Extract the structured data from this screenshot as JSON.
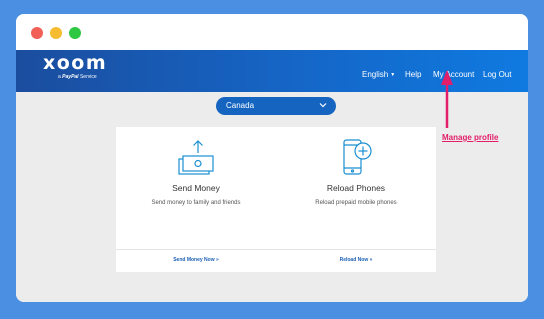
{
  "navbar": {
    "logo_word": "xoom",
    "logo_prefix": "a",
    "logo_brand": "PayPal",
    "logo_suffix": "Service",
    "language": "English",
    "help": "Help",
    "my_account": "My Account",
    "logout": "Log Out"
  },
  "country_select": {
    "value": "Canada"
  },
  "cards": [
    {
      "title": "Send Money",
      "description": "Send money to family and friends",
      "link": "Send Money Now »"
    },
    {
      "title": "Reload Phones",
      "description": "Reload prepaid mobile phones",
      "link": "Reload Now »"
    }
  ],
  "annotation": {
    "text": "Manage profile",
    "color": "#e21d69"
  },
  "colors": {
    "background": "#4b8fe2",
    "nav_start": "#1b4d9e",
    "nav_end": "#0f7ae0",
    "accent": "#1565c0",
    "icon": "#1a8fd1"
  }
}
